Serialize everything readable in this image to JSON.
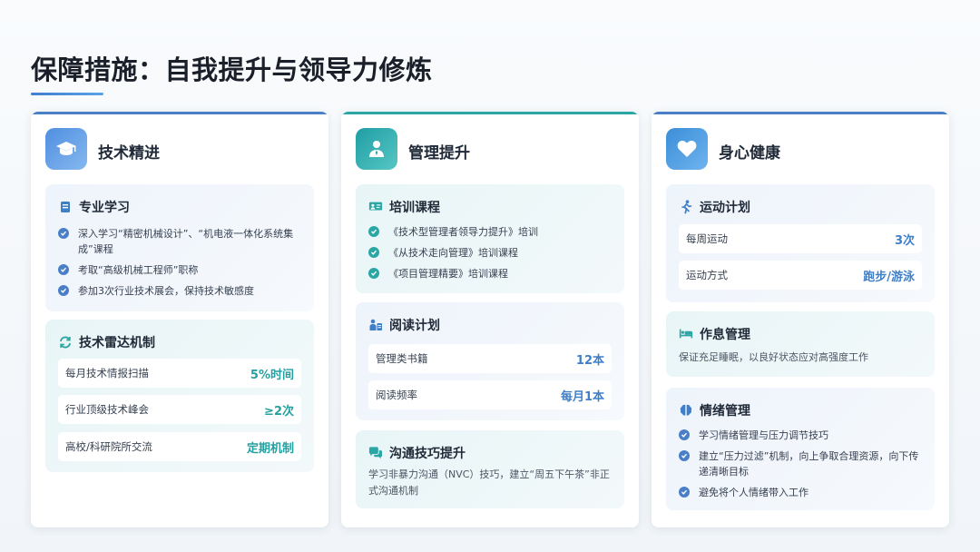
{
  "title": "保障措施：自我提升与领导力修炼",
  "colors": {
    "blue": "#4a7fc8",
    "teal": "#2aa6a5"
  },
  "cards": [
    {
      "icon": "graduation-cap-icon",
      "heading": "技术精进",
      "study": {
        "icon": "book-icon",
        "title": "专业学习",
        "items": [
          "深入学习“精密机械设计”、“机电液一体化系统集成”课程",
          "考取“高级机械工程师”职称",
          "参加3次行业技术展会，保持技术敏感度"
        ]
      },
      "radar": {
        "icon": "sync-icon",
        "title": "技术雷达机制",
        "rows": [
          {
            "label": "每月技术情报扫描",
            "value": "5%时间"
          },
          {
            "label": "行业顶级技术峰会",
            "value": "≥2次"
          },
          {
            "label": "高校/科研院所交流",
            "value": "定期机制"
          }
        ]
      }
    },
    {
      "icon": "user-tie-icon",
      "heading": "管理提升",
      "training": {
        "icon": "presentation-icon",
        "title": "培训课程",
        "items": [
          "《技术型管理者领导力提升》培训",
          "《从技术走向管理》培训课程",
          "《项目管理精要》培训课程"
        ]
      },
      "reading": {
        "icon": "reader-icon",
        "title": "阅读计划",
        "rows": [
          {
            "label": "管理类书籍",
            "value": "12本"
          },
          {
            "label": "阅读频率",
            "value": "每月1本"
          }
        ]
      },
      "communication": {
        "icon": "chat-icon",
        "title": "沟通技巧提升",
        "desc": "学习非暴力沟通（NVC）技巧，建立“周五下午茶”非正式沟通机制"
      }
    },
    {
      "icon": "heart-icon",
      "heading": "身心健康",
      "exercise": {
        "icon": "running-icon",
        "title": "运动计划",
        "rows": [
          {
            "label": "每周运动",
            "value": "3次"
          },
          {
            "label": "运动方式",
            "value": "跑步/游泳"
          }
        ]
      },
      "rest": {
        "icon": "bed-icon",
        "title": "作息管理",
        "desc": "保证充足睡眠，以良好状态应对高强度工作"
      },
      "emotion": {
        "icon": "brain-icon",
        "title": "情绪管理",
        "items": [
          "学习情绪管理与压力调节技巧",
          "建立“压力过滤”机制，向上争取合理资源，向下传递清晰目标",
          "避免将个人情绪带入工作"
        ]
      }
    }
  ]
}
